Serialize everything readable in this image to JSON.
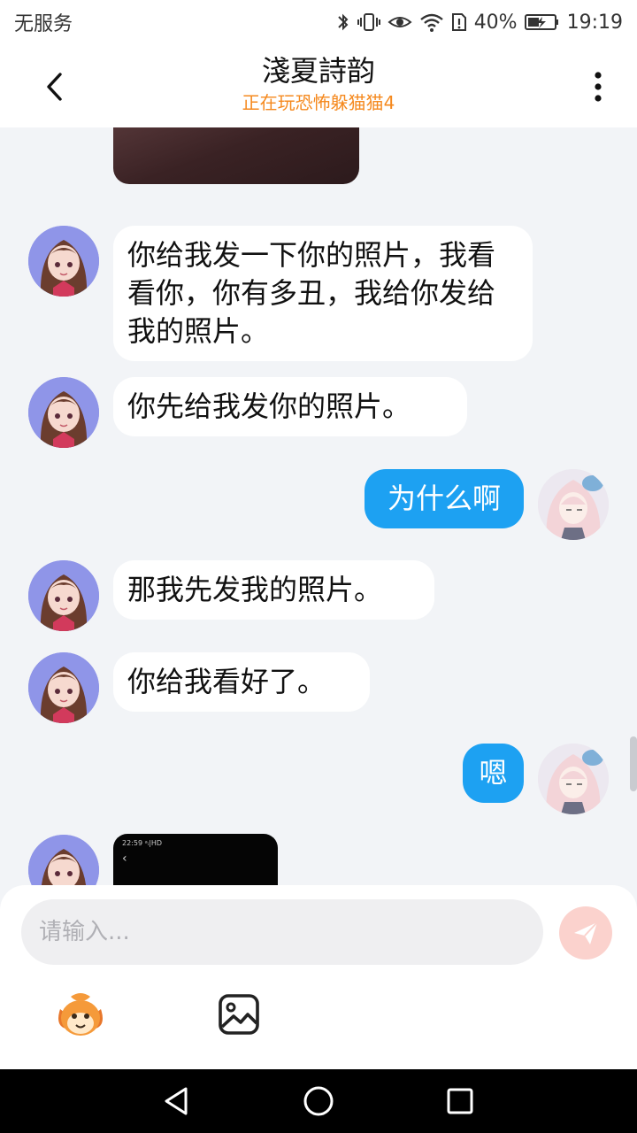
{
  "status_bar": {
    "carrier": "无服务",
    "battery_percent": "40%",
    "time": "19:19",
    "icons": [
      "bluetooth-icon",
      "vibrate-icon",
      "eye-comfort-icon",
      "wifi-icon",
      "sim-alert-icon",
      "battery-charging-icon"
    ]
  },
  "header": {
    "title": "淺夏詩韵",
    "subtitle": "正在玩恐怖躲猫猫4",
    "subtitle_color": "#f5891e"
  },
  "messages": [
    {
      "side": "incoming",
      "type": "image"
    },
    {
      "side": "incoming",
      "type": "text",
      "text": "你给我发一下你的照片，我看看你，你有多丑，我给你发给我的照片。"
    },
    {
      "side": "incoming",
      "type": "text",
      "text": "你先给我发你的照片。"
    },
    {
      "side": "outgoing",
      "type": "text",
      "text": "为什么啊"
    },
    {
      "side": "incoming",
      "type": "text",
      "text": "那我先发我的照片。"
    },
    {
      "side": "incoming",
      "type": "text",
      "text": "你给我看好了。"
    },
    {
      "side": "outgoing",
      "type": "text",
      "text": "嗯"
    },
    {
      "side": "incoming",
      "type": "image",
      "mini_status": "22:59 ᵃᵢ|HD",
      "mini_back": "‹"
    }
  ],
  "input": {
    "placeholder": "请输入..."
  },
  "toolbar": {
    "emoji_icon": "mascot-emoji-icon",
    "image_icon": "image-icon"
  },
  "colors": {
    "outgoing_bubble": "#1da1f2",
    "incoming_bubble": "#ffffff",
    "chat_background": "#f2f4f7",
    "send_button": "#fbd2cd"
  }
}
